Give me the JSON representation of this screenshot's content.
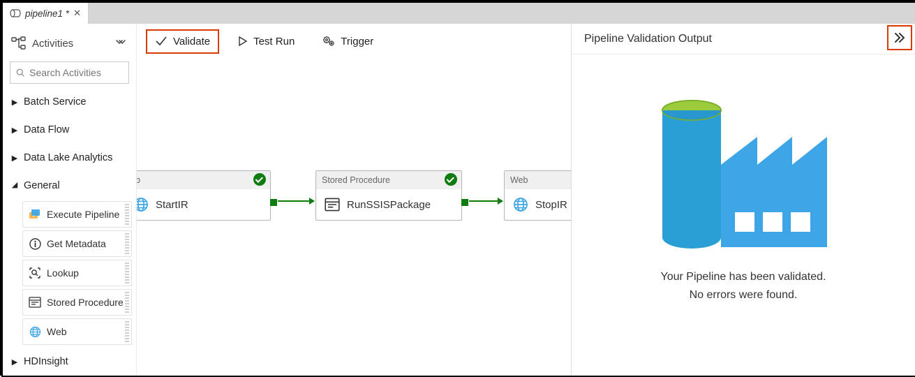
{
  "tab": {
    "title": "pipeline1 *"
  },
  "sidebar": {
    "title": "Activities",
    "search_placeholder": "Search Activities",
    "categories": {
      "batch": "Batch Service",
      "dataflow": "Data Flow",
      "dla": "Data Lake Analytics",
      "general": "General",
      "hdinsight": "HDInsight"
    },
    "general_items": {
      "execute_pipeline": "Execute Pipeline",
      "get_metadata": "Get Metadata",
      "lookup": "Lookup",
      "stored_procedure": "Stored Procedure",
      "web": "Web"
    }
  },
  "toolbar": {
    "validate": "Validate",
    "test_run": "Test Run",
    "trigger": "Trigger"
  },
  "nodes": {
    "startir": {
      "type": "eb",
      "name": "StartIR"
    },
    "runssis": {
      "type": "Stored Procedure",
      "name": "RunSSISPackage"
    },
    "stopir": {
      "type": "Web",
      "name": "StopIR"
    }
  },
  "panel": {
    "title": "Pipeline Validation Output",
    "line1": "Your Pipeline has been validated.",
    "line2": "No errors were found."
  },
  "colors": {
    "accent": "#0078d4",
    "green": "#107c10",
    "highlight": "#d83b01",
    "lime": "#9ccc3c"
  }
}
